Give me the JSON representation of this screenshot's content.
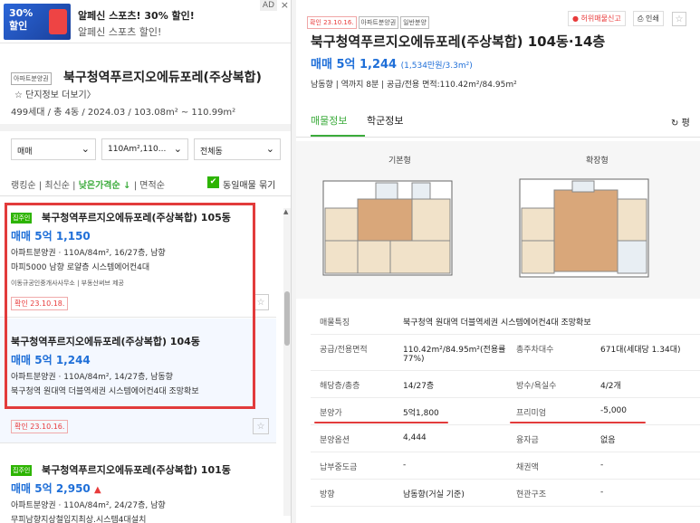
{
  "ad": {
    "badge": "AD",
    "close": "×",
    "thumb_text": "30%\n할인",
    "title": "알페신 스포츠! 30% 할인!",
    "subtitle": "알페신 스포츠 할인!"
  },
  "complex": {
    "tag": "아파트분양권",
    "title": "북구청역푸르지오에듀포레(주상복합)",
    "more_link": "단지정보 더보기",
    "info": "499세대 / 총 4동 / 2024.03 / 103.08m² ~ 110.99m²"
  },
  "filters": {
    "trade": "매매",
    "area": "110Am²,110...",
    "dong": "전체동"
  },
  "sort": {
    "ranking": "랭킹순",
    "latest": "최신순",
    "low_price": "낮은가격순",
    "area": "면적순",
    "same_listing": "동일매물 묶기"
  },
  "listings": [
    {
      "tag": "집주인",
      "title": "북구청역푸르지오에듀포레(주상복합) 105동",
      "price": "매매 5억 1,150",
      "meta": "아파트분양권 · 110A/84m², 16/27층, 남향",
      "desc": "마피5000 남향 로얄층 시스템에어컨4대",
      "agent": "이동규공인중개사사무소 | 부동산써브 제공",
      "confirm": "확인 23.10.18."
    },
    {
      "title": "북구청역푸르지오에듀포레(주상복합) 104동",
      "price": "매매 5억 1,244",
      "meta": "아파트분양권 · 110A/84m², 14/27층, 남동향",
      "desc": "북구청역 원대역 더블역세권 시스템에어컨4대 조망확보",
      "confirm": "확인 23.10.16."
    },
    {
      "tag": "집주인",
      "title": "북구청역푸르지오에듀포레(주상복합) 101동",
      "price": "매매 5억 2,950",
      "meta": "아파트분양권 · 110A/84m², 24/27층, 남향",
      "desc": "무피남향지상철입지최상.시스템4대설치"
    }
  ],
  "detail": {
    "confirm_tag": "확인 23.10.16.",
    "type_tag": "아파트분양권",
    "sale_tag": "일반분양",
    "report": "허위매물신고",
    "print": "인쇄",
    "title": "북구청역푸르지오에듀포레(주상복합) 104동·14층",
    "price": "매매 5억 1,244",
    "price_unit": "(1,534만원/3.3m²)",
    "info": "남동향 | 역까지 8분 | 공급/전용 면적:110.42m²/84.95m²",
    "tab_listing": "매물정보",
    "tab_school": "학군정보",
    "refresh": "평",
    "fp_basic": "기본형",
    "fp_ext": "확장형",
    "rows": [
      {
        "k": "매물특징",
        "v": "북구청역 원대역 더블역세권 시스템에어컨4대 조망확보",
        "wide": true
      },
      {
        "k": "공급/전용면적",
        "v": "110.42m²/84.95m²(전용률77%)",
        "k2": "총주차대수",
        "v2": "671대(세대당 1.34대)"
      },
      {
        "k": "해당층/총층",
        "v": "14/27층",
        "k2": "방수/욕실수",
        "v2": "4/2개"
      },
      {
        "k": "분양가",
        "v": "5억1,800",
        "k2": "프리미엄",
        "v2": "-5,000"
      },
      {
        "k": "분양옵션",
        "v": "4,444",
        "k2": "융자금",
        "v2": "없음"
      },
      {
        "k": "납부중도금",
        "v": "-",
        "k2": "채권액",
        "v2": "-"
      },
      {
        "k": "방향",
        "v": "남동향(거실 기준)",
        "k2": "현관구조",
        "v2": "-"
      }
    ]
  },
  "colors": {
    "accent_green": "#3bab3b",
    "price_blue": "#1f6fd8",
    "highlight_red": "#e23b3b"
  }
}
